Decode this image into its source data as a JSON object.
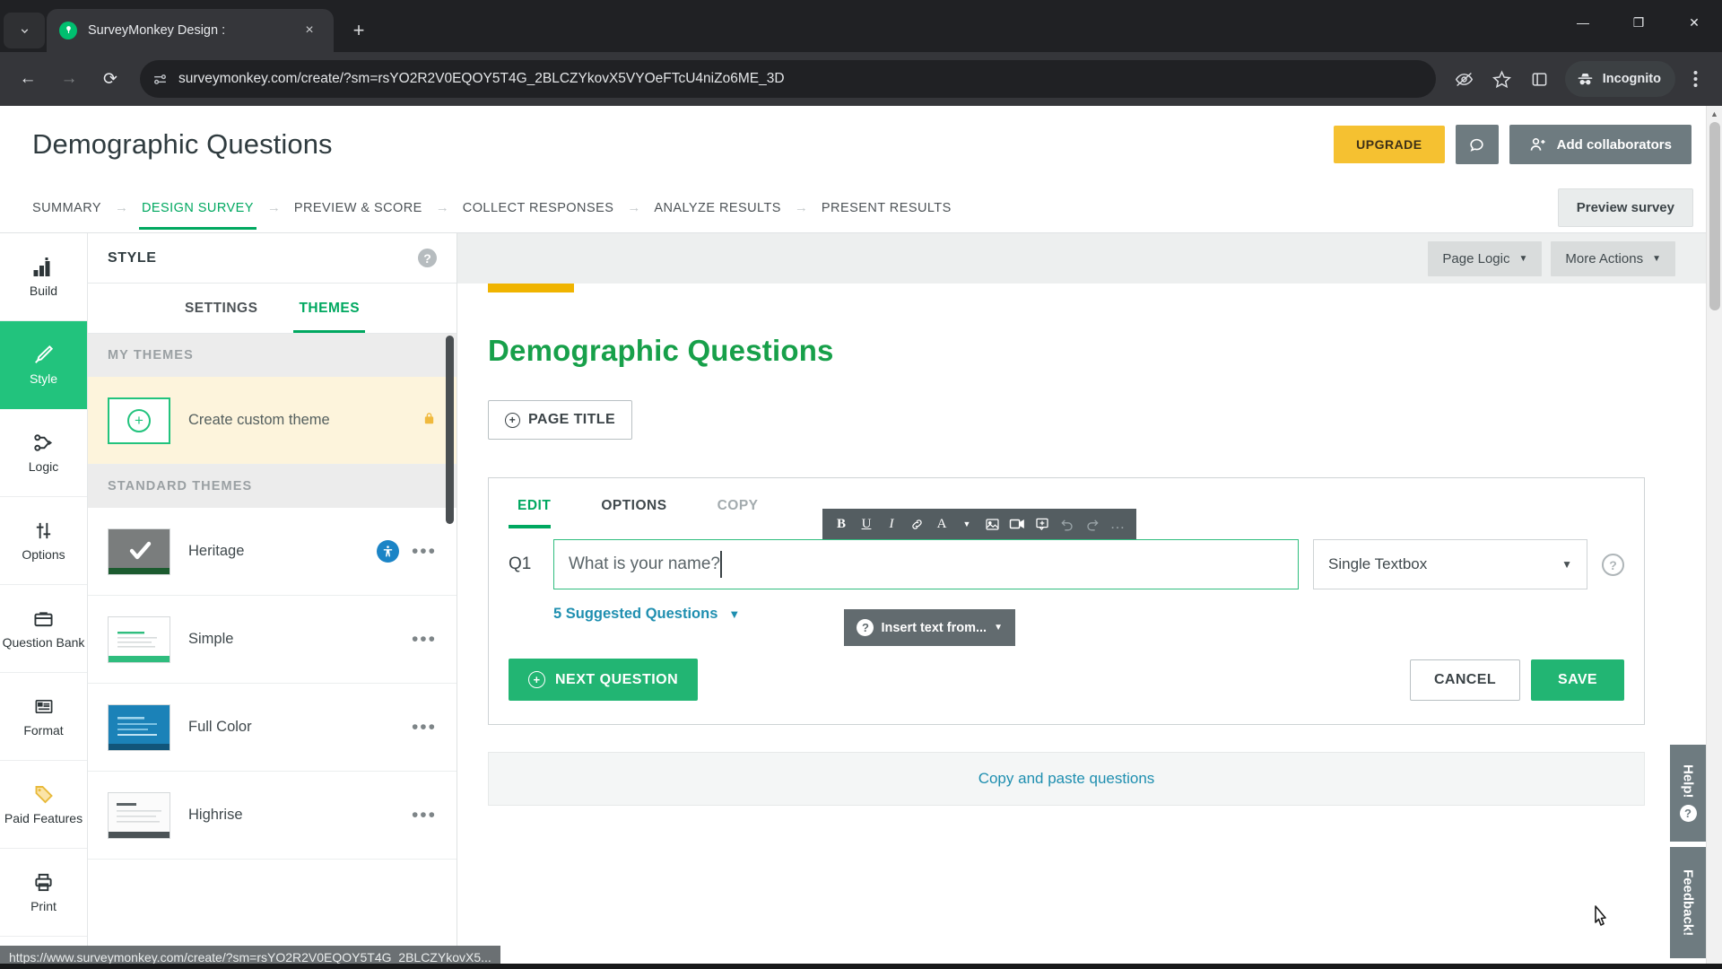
{
  "browser": {
    "tab": {
      "title": "SurveyMonkey Design :",
      "favicon_icon": "surveymonkey-logo-icon",
      "close_icon": "×"
    },
    "tab_search_icon": "chevron-down-icon",
    "new_tab_icon": "+",
    "window_controls": {
      "minimize": "—",
      "maximize": "❐",
      "close": "✕"
    },
    "nav": {
      "back_icon": "←",
      "forward_icon": "→",
      "reload_icon": "⟳"
    },
    "omnibox": {
      "site_icon": "site-settings-icon",
      "url": "surveymonkey.com/create/?sm=rsYO2R2V0EQOY5T4G_2BLCZYkovX5VYOeFTcU4niZo6ME_3D"
    },
    "toolbar_right": {
      "tracking_protection_icon": "eye-slash-icon",
      "bookmark_icon": "star-icon",
      "side_panel_icon": "side-panel-icon",
      "incognito_label": "Incognito",
      "menu_icon": "three-dots-vertical-icon"
    },
    "status_bar_url": "https://www.surveymonkey.com/create/?sm=rsYO2R2V0EQOY5T4G_2BLCZYkovX5..."
  },
  "header": {
    "survey_title": "Demographic Questions",
    "upgrade_label": "UPGRADE",
    "chat_icon": "speech-bubble-icon",
    "collaborators_label": "Add collaborators",
    "collaborators_icon": "add-person-icon",
    "preview_label": "Preview survey"
  },
  "breadcrumbs": {
    "separator": "→",
    "items": [
      {
        "label": "SUMMARY",
        "active": false
      },
      {
        "label": "DESIGN SURVEY",
        "active": true
      },
      {
        "label": "PREVIEW & SCORE",
        "active": false
      },
      {
        "label": "COLLECT RESPONSES",
        "active": false
      },
      {
        "label": "ANALYZE RESULTS",
        "active": false
      },
      {
        "label": "PRESENT RESULTS",
        "active": false
      }
    ]
  },
  "rail": {
    "items": [
      {
        "label": "Build",
        "icon": "build-bars-icon",
        "active": false
      },
      {
        "label": "Style",
        "icon": "paintbrush-icon",
        "active": true
      },
      {
        "label": "Logic",
        "icon": "branch-logic-icon",
        "active": false
      },
      {
        "label": "Options",
        "icon": "sliders-icon",
        "active": false
      },
      {
        "label": "Question Bank",
        "icon": "bank-icon",
        "active": false
      },
      {
        "label": "Format",
        "icon": "format-grid-icon",
        "active": false
      },
      {
        "label": "Paid Features",
        "icon": "price-tag-icon",
        "active": false
      },
      {
        "label": "Print",
        "icon": "printer-icon",
        "active": false
      }
    ]
  },
  "style_panel": {
    "heading": "STYLE",
    "help_icon": "question-mark-icon",
    "tabs": [
      {
        "label": "SETTINGS",
        "active": false
      },
      {
        "label": "THEMES",
        "active": true
      }
    ],
    "my_themes_heading": "MY THEMES",
    "create_custom": {
      "label": "Create custom theme",
      "plus_icon": "plus-circle-icon",
      "lock_icon": "lock-icon"
    },
    "standard_heading": "STANDARD THEMES",
    "themes": [
      {
        "name": "Heritage",
        "selected": true,
        "accessible": true,
        "thumb_bg": "#7a7d7d",
        "thumb_bar": "#1c5b2f",
        "menu_icon": "ellipsis-icon",
        "a11y_icon": "accessibility-icon"
      },
      {
        "name": "Simple",
        "selected": false,
        "accessible": false,
        "thumb_bg": "#ffffff",
        "thumb_bar": "#2fbd7e",
        "menu_icon": "ellipsis-icon"
      },
      {
        "name": "Full Color",
        "selected": false,
        "accessible": false,
        "thumb_bg": "#1b82b8",
        "thumb_bar": "#11557a",
        "menu_icon": "ellipsis-icon"
      },
      {
        "name": "Highrise",
        "selected": false,
        "accessible": false,
        "thumb_bg": "#fbfbfb",
        "thumb_bar": "#4b5356",
        "menu_icon": "ellipsis-icon"
      }
    ]
  },
  "canvas": {
    "page_logic_label": "Page Logic",
    "more_actions_label": "More Actions",
    "caret_icon": "caret-down-icon",
    "survey_heading": "Demographic Questions",
    "page_title_label": "PAGE TITLE",
    "copy_paste_label": "Copy and paste questions"
  },
  "question_card": {
    "tabs": [
      {
        "label": "EDIT",
        "active": true,
        "dim": false
      },
      {
        "label": "OPTIONS",
        "active": false,
        "dim": false
      },
      {
        "label": "COPY",
        "active": false,
        "dim": true
      }
    ],
    "number": "Q1",
    "text_value": "What is your name?",
    "type_value": "Single Textbox",
    "help_icon": "question-mark-icon",
    "rte_buttons": [
      {
        "icon": "bold-icon",
        "glyph": "B",
        "dim": false
      },
      {
        "icon": "underline-icon",
        "glyph": "U",
        "dim": false
      },
      {
        "icon": "italic-icon",
        "glyph": "I",
        "dim": false
      },
      {
        "icon": "link-icon",
        "glyph": "🔗",
        "dim": false
      },
      {
        "icon": "text-color-icon",
        "glyph": "A",
        "dim": false
      },
      {
        "icon": "color-caret-icon",
        "glyph": "▾",
        "dim": false
      },
      {
        "icon": "insert-image-icon",
        "glyph": "🖼",
        "dim": false
      },
      {
        "icon": "insert-video-icon",
        "glyph": "🎥",
        "dim": false
      },
      {
        "icon": "insert-media-icon",
        "glyph": "⊞",
        "dim": false
      },
      {
        "icon": "undo-icon",
        "glyph": "↰",
        "dim": true
      },
      {
        "icon": "redo-icon",
        "glyph": "↱",
        "dim": true
      },
      {
        "icon": "more-options-icon",
        "glyph": "…",
        "dim": true
      }
    ],
    "insert_text_label": "Insert text from...",
    "insert_text_icon": "question-mark-icon",
    "suggested_label": "5 Suggested Questions",
    "next_question_label": "NEXT QUESTION",
    "cancel_label": "CANCEL",
    "save_label": "SAVE"
  },
  "side_tabs": {
    "help_label": "Help!",
    "help_icon": "question-mark-icon",
    "feedback_label": "Feedback!"
  },
  "colors": {
    "brand_green": "#00a860",
    "button_green": "#22b573",
    "rail_active": "#22c37d",
    "upgrade_yellow": "#f5c131",
    "heading_green": "#17a04a",
    "accent_yellow": "#f0b400",
    "link_blue": "#1f8fb0",
    "slate": "#6e7b80"
  }
}
